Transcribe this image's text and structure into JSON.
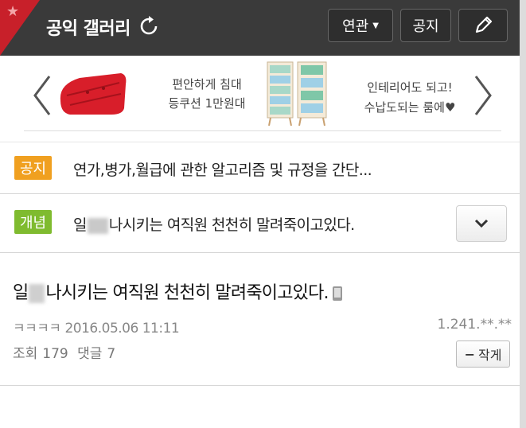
{
  "header": {
    "title": "공익 갤러리",
    "related_label": "연관",
    "notice_label": "공지",
    "icons": [
      "star-icon",
      "refresh-icon",
      "caret-down-icon",
      "pencil-icon"
    ]
  },
  "ad": {
    "left_text_line1": "편안하게 침대",
    "left_text_line2": "등쿠션 1만원대",
    "right_text_line1": "인테리어도 되고!",
    "right_text_line2": "수납도되는 룸에♥"
  },
  "notice": {
    "tag": "공지",
    "text": "연가,병가,월급에 관한 알고리즘 및 규정을 간단..."
  },
  "concept": {
    "tag": "개념",
    "text_prefix": "일",
    "text_suffix": "나시키는 여직원 천천히 말려죽이고있다."
  },
  "post": {
    "title_prefix": "일",
    "title_suffix": "나시키는 여직원 천천히 말려죽이고있다.",
    "author": "ㅋㅋㅋㅋ",
    "datetime": "2016.05.06 11:11",
    "ip": "1.241.**.**",
    "views_label": "조회",
    "views": "179",
    "comments_label": "댓글",
    "comments": "7",
    "font_button_label": "작게"
  },
  "colors": {
    "header_bg": "#3a3a3a",
    "corner_red": "#c8202a",
    "notice_tag": "#f0a020",
    "concept_tag": "#7fbb2f"
  }
}
